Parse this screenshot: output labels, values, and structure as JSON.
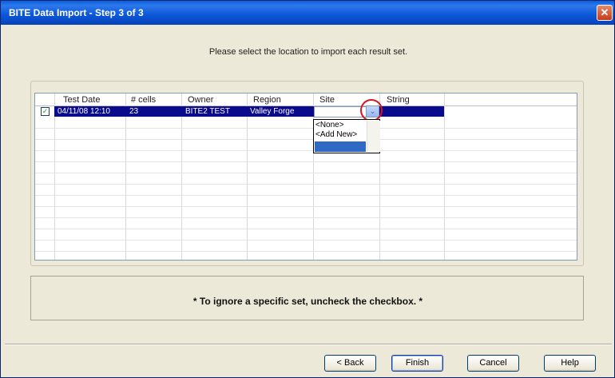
{
  "window": {
    "title": "BITE Data Import - Step 3 of 3",
    "close_glyph": "✕"
  },
  "instruction": "Please select the location to import each result set.",
  "grid": {
    "columns": [
      "Test Date",
      "# cells",
      "Owner",
      "Region",
      "Site",
      "String"
    ],
    "rows": [
      {
        "checked": true,
        "test_date": "04/11/08 12:10",
        "cells": "23",
        "owner": "BITE2 TEST",
        "region": "Valley Forge",
        "site": "",
        "string": ""
      }
    ],
    "site_dropdown": {
      "options": [
        "<None>",
        "<Add New>",
        ""
      ],
      "highlighted_index": 2
    }
  },
  "note": "* To ignore a specific set, uncheck the checkbox. *",
  "buttons": {
    "back": "< Back",
    "finish": "Finish",
    "cancel": "Cancel",
    "help": "Help"
  },
  "colors": {
    "title_bar": "#0b56d8",
    "selection": "#0a0a8c",
    "highlight_circle": "#e01020"
  },
  "icons": {
    "checkbox": "✓",
    "dropdown_arrow": "⌄"
  }
}
